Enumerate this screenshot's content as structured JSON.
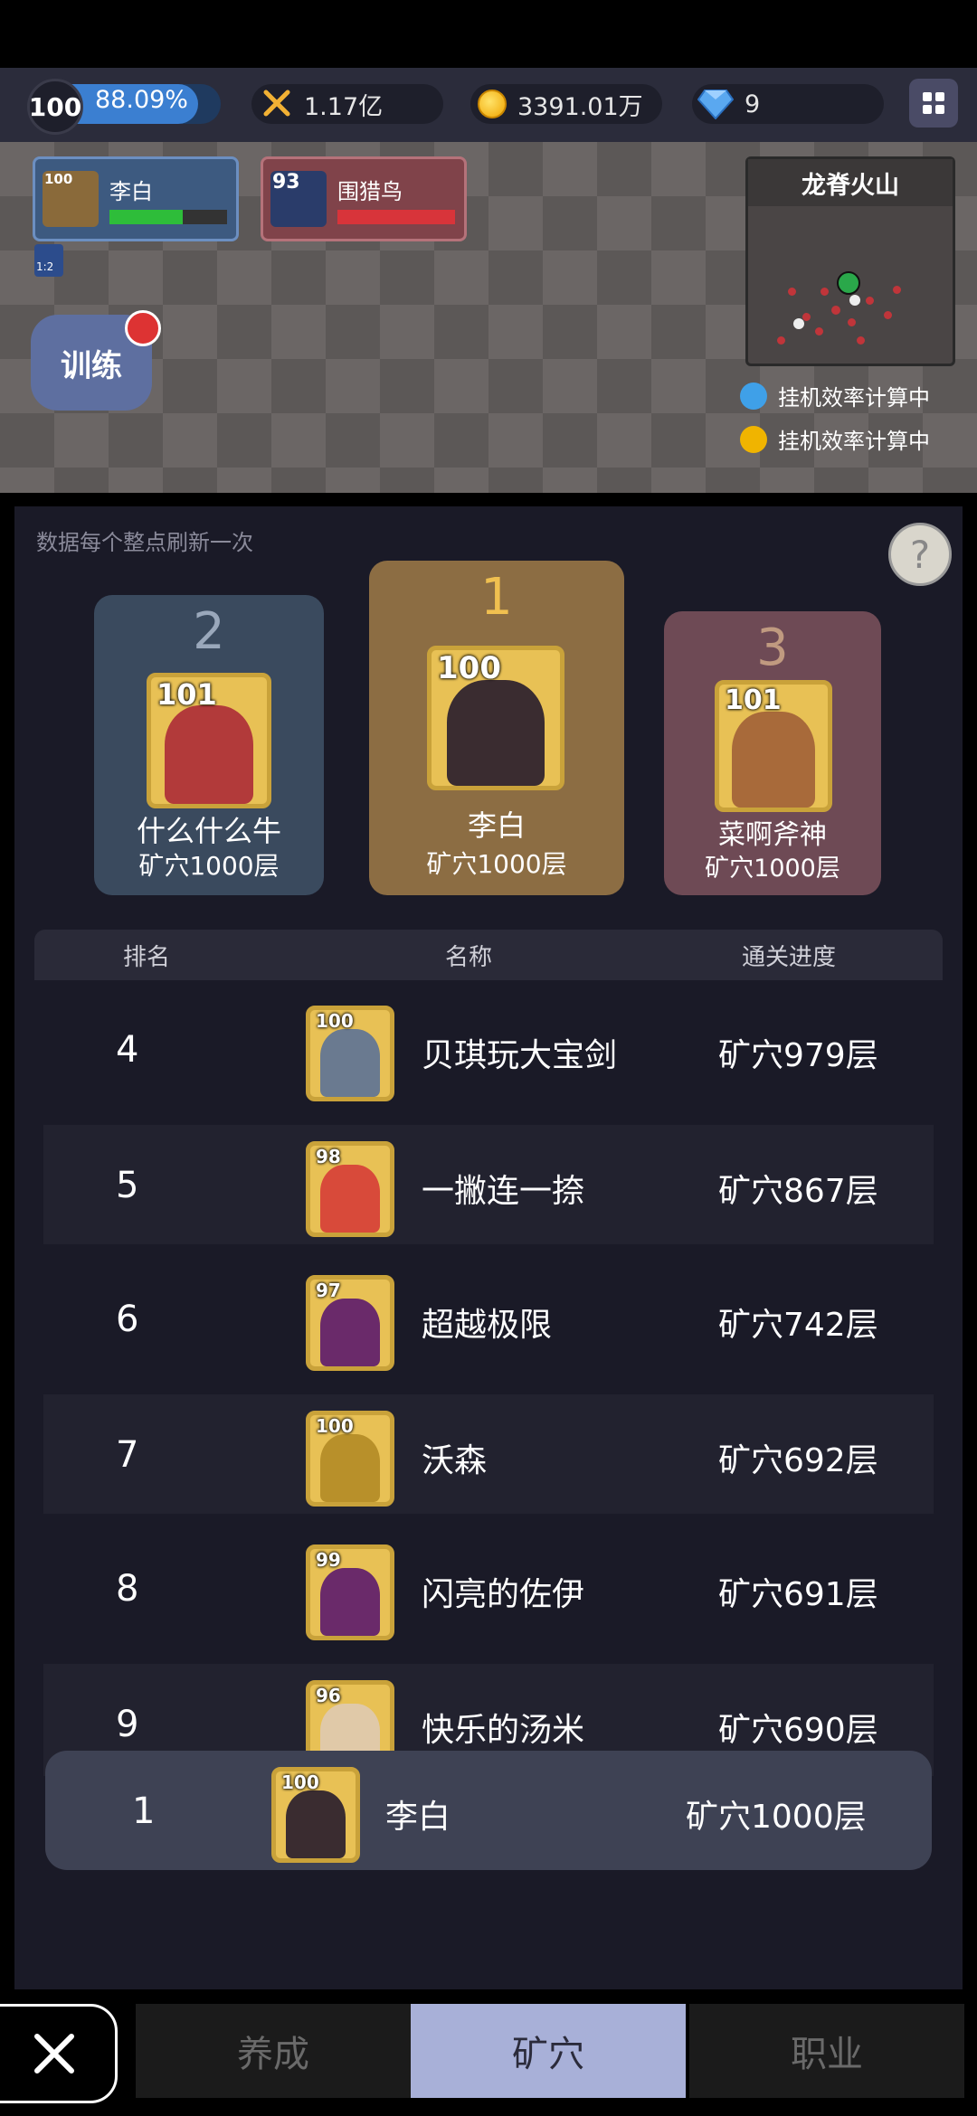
{
  "top_bar": {
    "level": "100",
    "exp_percent": "88.09%",
    "power": "1.17亿",
    "gold": "3391.01万",
    "gems": "9"
  },
  "map": {
    "hero_player": {
      "level": "100",
      "name": "李白",
      "hp_fraction": 0.62
    },
    "hero_enemy": {
      "level": "93",
      "name": "围猎鸟",
      "hp_fraction": 1.0
    },
    "sword_badge": "1:2",
    "train_label": "训练",
    "minimap_title": "龙脊火山",
    "efficiency_rows": [
      "挂机效率计算中",
      "挂机效率计算中"
    ]
  },
  "panel": {
    "notice": "数据每个整点刷新一次",
    "help_label": "?",
    "podium": [
      {
        "rank": "1",
        "level": "100",
        "name": "李白",
        "progress": "矿穴1000层"
      },
      {
        "rank": "2",
        "level": "101",
        "name": "什么什么牛",
        "progress": "矿穴1000层"
      },
      {
        "rank": "3",
        "level": "101",
        "name": "菜啊斧神",
        "progress": "矿穴1000层"
      }
    ],
    "columns": [
      "排名",
      "名称",
      "通关进度"
    ],
    "rows": [
      {
        "rank": "4",
        "level": "100",
        "name": "贝琪玩大宝剑",
        "progress": "矿穴979层"
      },
      {
        "rank": "5",
        "level": "98",
        "name": "一撇连一捺",
        "progress": "矿穴867层"
      },
      {
        "rank": "6",
        "level": "97",
        "name": "超越极限",
        "progress": "矿穴742层"
      },
      {
        "rank": "7",
        "level": "100",
        "name": "沃森",
        "progress": "矿穴692层"
      },
      {
        "rank": "8",
        "level": "99",
        "name": "闪亮的佐伊",
        "progress": "矿穴691层"
      },
      {
        "rank": "9",
        "level": "96",
        "name": "快乐的汤米",
        "progress": "矿穴690层"
      }
    ],
    "self_row": {
      "rank": "1",
      "level": "100",
      "name": "李白",
      "progress": "矿穴1000层"
    }
  },
  "tabs": [
    {
      "label": "养成",
      "active": false
    },
    {
      "label": "矿穴",
      "active": true
    },
    {
      "label": "职业",
      "active": false
    }
  ],
  "colors": {
    "panel_bg": "#1a1a27",
    "active_tab": "#a8b0d8",
    "rank1_card": "#8c6d43",
    "rank2_card": "#3a4a5e",
    "rank3_card": "#6e4a55"
  }
}
